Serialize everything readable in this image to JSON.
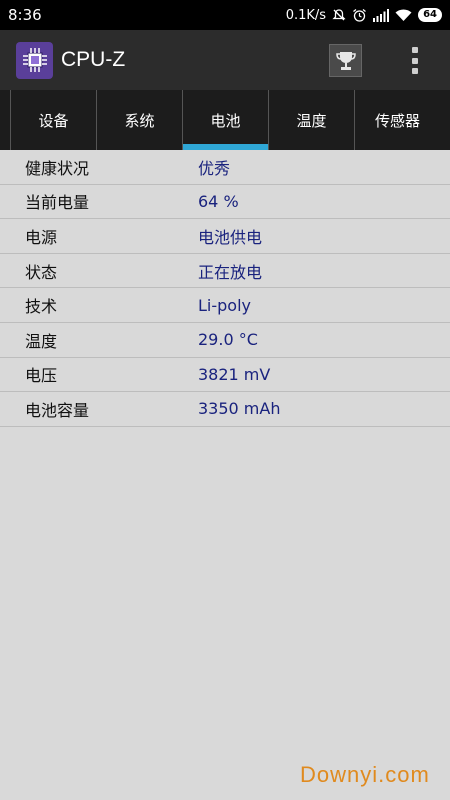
{
  "status_bar": {
    "time": "8:36",
    "net_speed": "0.1K/s",
    "battery_level": "64"
  },
  "app": {
    "title": "CPU-Z",
    "logo_icon": "cpu-chip-icon",
    "trophy_icon": "trophy-icon",
    "menu_icon": "overflow-menu-icon",
    "accent_color": "#2fa7d6"
  },
  "tabs": [
    {
      "label": "设备"
    },
    {
      "label": "系统"
    },
    {
      "label": "电池",
      "active": true
    },
    {
      "label": "温度"
    },
    {
      "label": "传感器"
    }
  ],
  "battery_info": [
    {
      "label": "健康状况",
      "value": "优秀"
    },
    {
      "label": "当前电量",
      "value": "64 %"
    },
    {
      "label": "电源",
      "value": "电池供电"
    },
    {
      "label": "状态",
      "value": "正在放电"
    },
    {
      "label": "技术",
      "value": "Li-poly"
    },
    {
      "label": "温度",
      "value": "29.0 °C"
    },
    {
      "label": "电压",
      "value": "3821 mV"
    },
    {
      "label": "电池容量",
      "value": "3350 mAh"
    }
  ],
  "watermark": "Downyi.com"
}
